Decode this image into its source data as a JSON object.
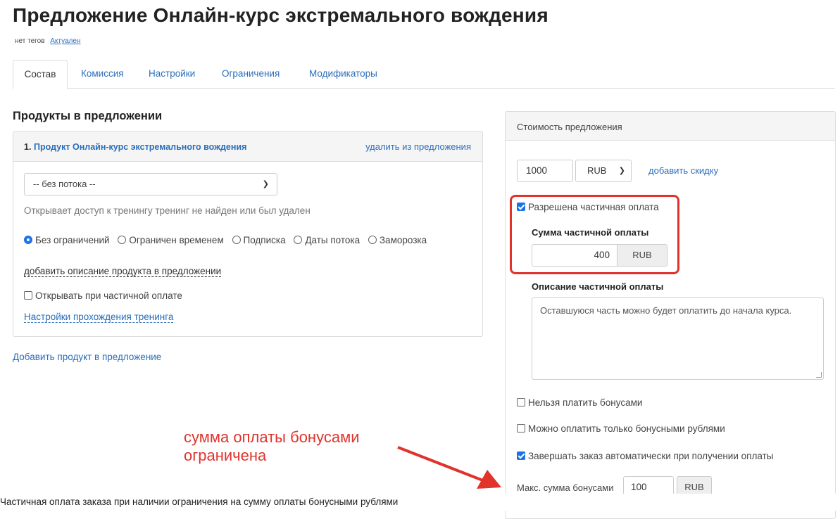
{
  "page": {
    "title": "Предложение Онлайн-курс экстремального вождения",
    "tags": "нет тегов",
    "status": "Актуален"
  },
  "tabs": [
    "Состав",
    "Комиссия",
    "Настройки",
    "Ограничения",
    "Модификаторы"
  ],
  "products": {
    "section_title": "Продукты в предложении",
    "item_number": "1.",
    "item_name": "Продукт Онлайн-курс экстремального вождения",
    "remove_label": "удалить из предложения",
    "stream_select": "-- без потока --",
    "access_note": "Открывает доступ к тренингу тренинг не найден или был удален",
    "limit_options": [
      "Без ограничений",
      "Ограничен временем",
      "Подписка",
      "Даты потока",
      "Заморозка"
    ],
    "limit_selected": "Без ограничений",
    "add_description": "добавить описание продукта в предложении",
    "open_on_partial": "Открывать при частичной оплате",
    "open_on_partial_checked": false,
    "training_settings": "Настройки прохождения тренинга",
    "add_product": "Добавить продукт в предложение"
  },
  "pricing": {
    "header": "Стоимость предложения",
    "price": "1000",
    "currency": "RUB",
    "add_discount": "добавить скидку",
    "partial_allowed_label": "Разрешена частичная оплата",
    "partial_allowed_checked": true,
    "partial_sum_label": "Сумма частичной оплаты",
    "partial_sum": "400",
    "partial_currency": "RUB",
    "partial_desc_label": "Описание частичной оплаты",
    "partial_desc": "Оставшуюся часть можно будет оплатить до начала курса.",
    "no_bonus_label": "Нельзя платить бонусами",
    "no_bonus_checked": false,
    "only_bonus_label": "Можно оплатить только бонусными рублями",
    "only_bonus_checked": false,
    "auto_complete_label": "Завершать заказ автоматически при получении оплаты",
    "auto_complete_checked": true,
    "max_bonus_label": "Макс. сумма бонусами",
    "max_bonus": "100",
    "max_bonus_currency": "RUB"
  },
  "annotation": {
    "line1": "сумма оплаты бонусами",
    "line2": "ограничена",
    "color": "#e0332c"
  },
  "caption": "Частичная оплата заказа при наличии ограничения на сумму оплаты бонусными рублями"
}
